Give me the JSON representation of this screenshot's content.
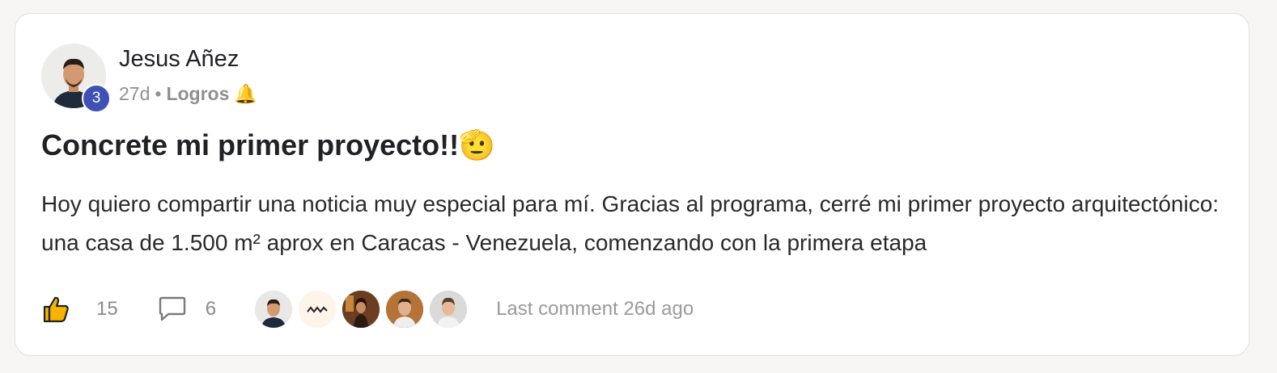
{
  "post": {
    "author": {
      "name": "Jesus Añez",
      "level": "3"
    },
    "meta": {
      "time_ago": "27d",
      "separator": "•",
      "category": "Logros",
      "category_emoji": "🔔"
    },
    "title": "Concrete mi primer proyecto!!",
    "title_emoji": "🫡",
    "body": "Hoy quiero compartir una noticia muy especial para mí. Gracias al programa, cerré mi primer proyecto arquitectónico: una casa de 1.500 m² aprox en Caracas - Venezuela, comenzando con la primera etapa",
    "footer": {
      "like_icon": "thumbs-up-icon",
      "likes": "15",
      "comment_icon": "comment-bubble-icon",
      "comments": "6",
      "last_comment": "Last comment 26d ago"
    }
  },
  "colors": {
    "badge": "#3f51b5",
    "card_border": "#e2e0dc",
    "page_bg": "#f7f6f4"
  }
}
